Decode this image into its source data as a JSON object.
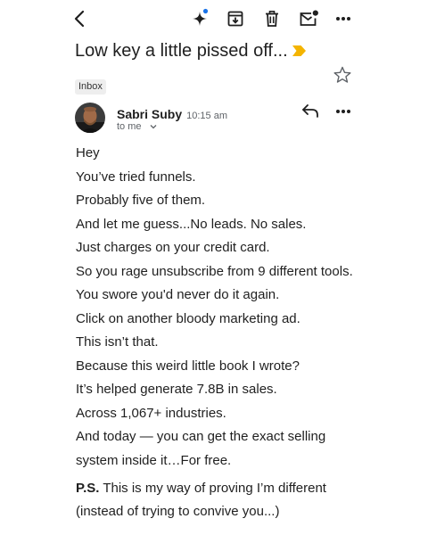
{
  "toolbar": {
    "back_icon": "back-arrow-icon",
    "gemini_icon": "gemini-sparkle-icon",
    "archive_icon": "archive-icon",
    "delete_icon": "trash-icon",
    "mark_unread_icon": "mark-unread-icon",
    "more_icon": "more-horizontal-icon"
  },
  "subject": {
    "text": "Low key a little pissed off...",
    "importance_icon": "important-marker-icon",
    "star_icon": "star-icon"
  },
  "label": "Inbox",
  "message": {
    "sender_name": "Sabri Suby",
    "time": "10:15 am",
    "recipient": "to me",
    "reply_icon": "reply-icon",
    "more_icon": "more-horizontal-icon"
  },
  "body": {
    "lines": [
      "Hey",
      "You’ve tried funnels.",
      "Probably five of them.",
      "And let me guess...No leads. No sales.",
      "Just charges on your credit card.",
      "So you rage unsubscribe from 9 different tools.",
      "You swore you'd never do it again.",
      "Click on another bloody marketing ad.",
      "This isn’t that.",
      "Because this weird little book I wrote?",
      "It’s helped generate 7.8B in sales.",
      "Across 1,067+ industries.",
      "And today — you can get the exact selling",
      "system inside it…For free."
    ],
    "ps_label": "P.S.",
    "ps_text": " This is my way of proving I’m different",
    "ps_line2": "(instead of trying to convive you...)"
  },
  "colors": {
    "accent_blue": "#1a73e8",
    "importance_yellow": "#f4b400",
    "text": "#1f1f1f",
    "secondary_text": "#5f6368"
  }
}
